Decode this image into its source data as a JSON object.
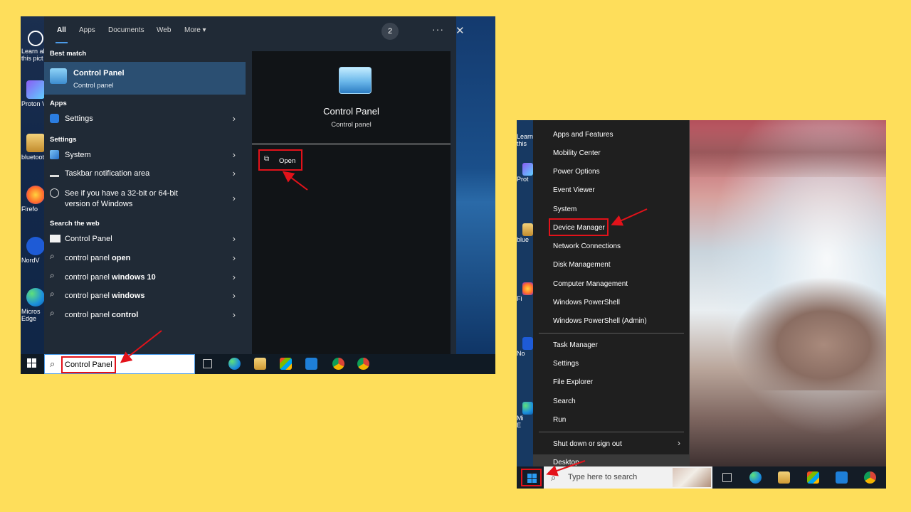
{
  "left": {
    "filters": {
      "all": "All",
      "apps": "Apps",
      "documents": "Documents",
      "web": "Web",
      "more": "More ▾",
      "count": "2",
      "more_options": "···",
      "close": "✕"
    },
    "desktop_icons": [
      {
        "label": "Learn ab",
        "label2": "this pict"
      },
      {
        "label": "Proton V"
      },
      {
        "label": "bluetoot"
      },
      {
        "label": "Firefo"
      },
      {
        "label": "NordV"
      },
      {
        "label": "Micros",
        "label2": "Edge"
      }
    ],
    "best_match": {
      "heading": "Best match",
      "title": "Control Panel",
      "subtitle": "Control panel"
    },
    "apps": {
      "heading": "Apps",
      "items": [
        {
          "label": "Settings"
        }
      ]
    },
    "settings": {
      "heading": "Settings",
      "items": [
        {
          "label": "System"
        },
        {
          "label": "Taskbar notification area"
        },
        {
          "label": "See if you have a 32-bit or 64-bit",
          "label2": "version of Windows"
        }
      ]
    },
    "web": {
      "heading": "Search the web",
      "items": [
        {
          "prefix": "Control Panel",
          "bold": ""
        },
        {
          "prefix": "control panel ",
          "bold": "open"
        },
        {
          "prefix": "control panel ",
          "bold": "windows 10"
        },
        {
          "prefix": "control panel ",
          "bold": "windows"
        },
        {
          "prefix": "control panel ",
          "bold": "control"
        }
      ]
    },
    "detail": {
      "title": "Control Panel",
      "subtitle": "Control panel",
      "open_label": "Open"
    },
    "taskbar": {
      "search_value": "Control Panel"
    }
  },
  "right": {
    "desktop_icons": [
      {
        "label": "Learn",
        "label2": "this"
      },
      {
        "label": "Prot"
      },
      {
        "label": "blue"
      },
      {
        "label": "Fi"
      },
      {
        "label": "No"
      },
      {
        "label": "Mi",
        "label2": "E"
      }
    ],
    "menu": {
      "group1": [
        "Apps and Features",
        "Mobility Center",
        "Power Options",
        "Event Viewer",
        "System",
        "Device Manager",
        "Network Connections",
        "Disk Management",
        "Computer Management",
        "Windows PowerShell",
        "Windows PowerShell (Admin)"
      ],
      "group2": [
        "Task Manager",
        "Settings",
        "File Explorer",
        "Search",
        "Run"
      ],
      "group3": [
        "Shut down or sign out",
        "Desktop"
      ],
      "submenu_arrow": "›"
    },
    "taskbar": {
      "search_placeholder": "Type here to search"
    }
  },
  "colors": {
    "background": "#FEDE5B",
    "highlight_red": "#E3121A",
    "accent_blue": "#4C9BE8"
  }
}
